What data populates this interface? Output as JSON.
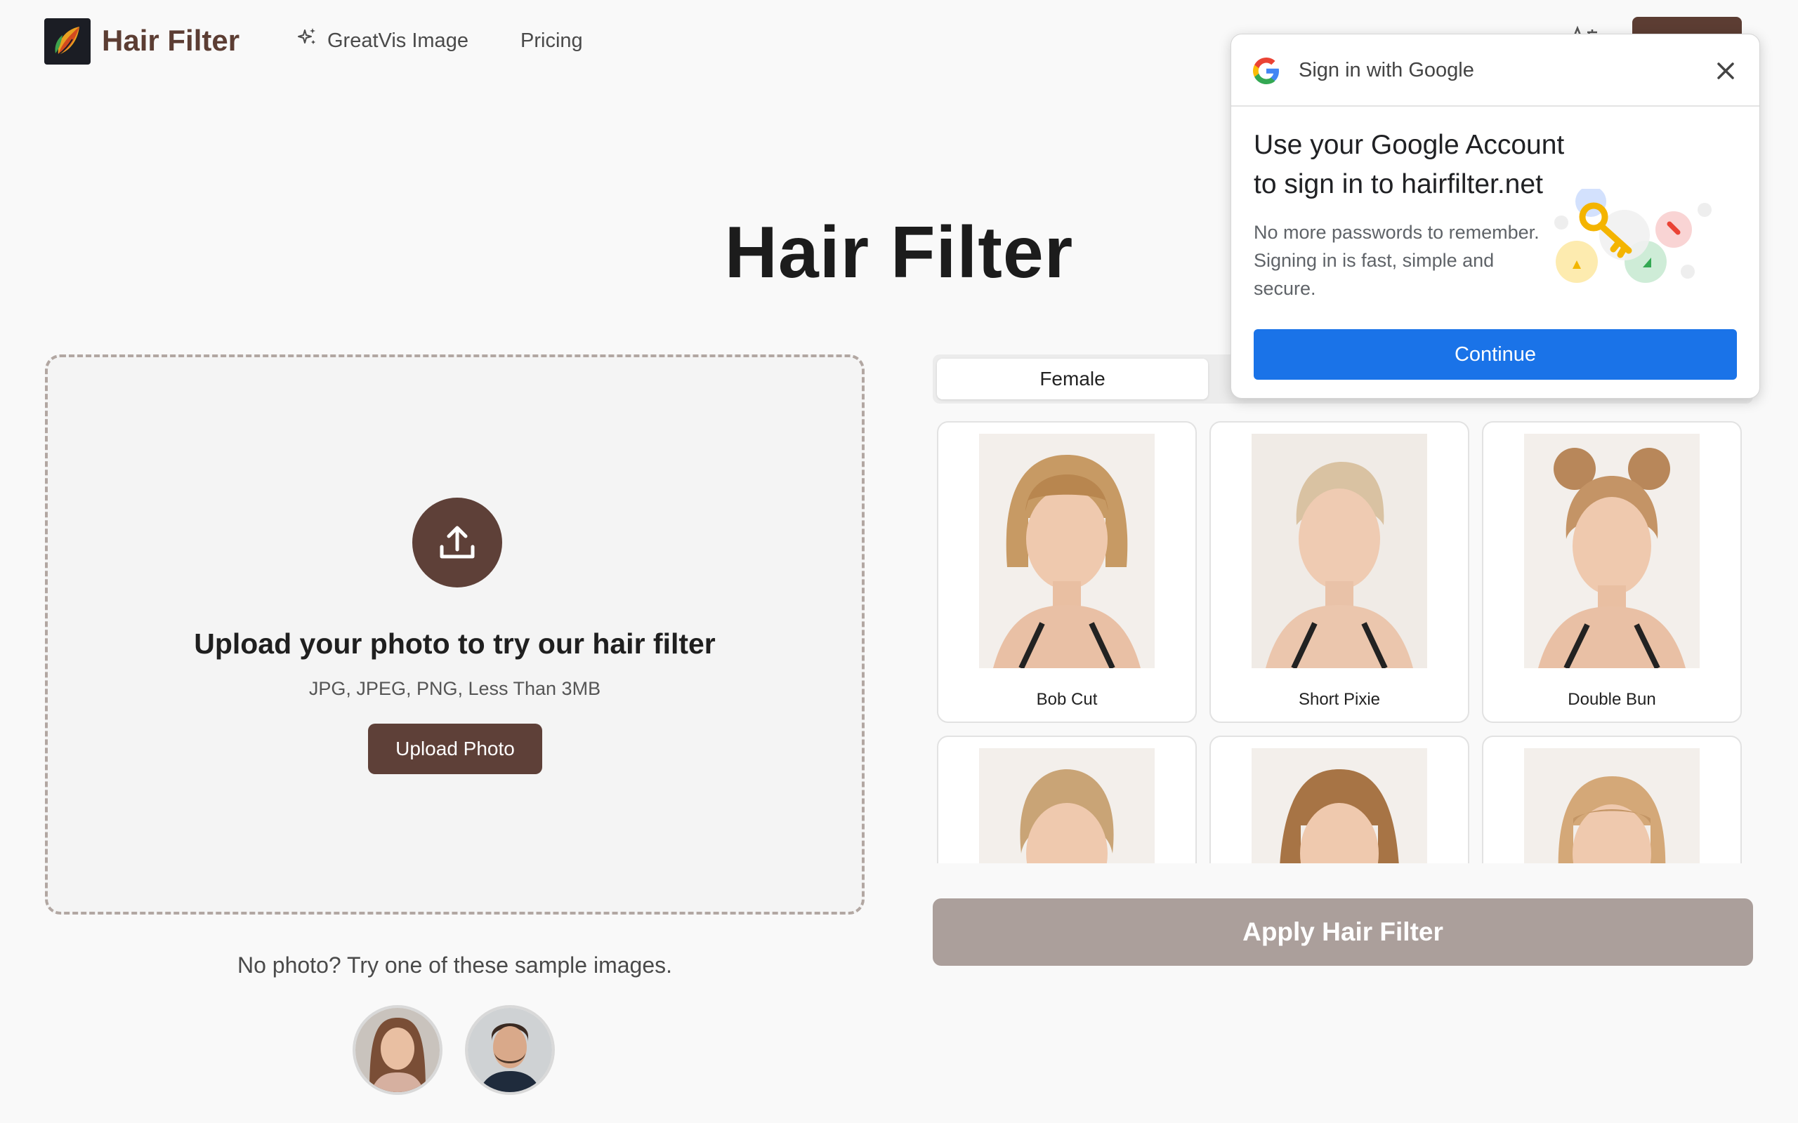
{
  "header": {
    "brand": "Hair Filter",
    "nav": [
      {
        "label": "GreatVis Image",
        "icon": "sparkle-icon"
      },
      {
        "label": "Pricing"
      }
    ],
    "brand_color": "#5c3d33"
  },
  "main": {
    "title": "Hair Filter"
  },
  "upload": {
    "heading": "Upload your photo to try our hair filter",
    "formats": "JPG, JPEG, PNG, Less Than 3MB",
    "button_label": "Upload Photo",
    "icon": "upload-icon"
  },
  "samples": {
    "text": "No photo? Try one of these sample images."
  },
  "style_panel": {
    "tabs": [
      {
        "label": "Female",
        "selected": true
      }
    ],
    "styles": [
      {
        "label": "Bob Cut"
      },
      {
        "label": "Short Pixie"
      },
      {
        "label": "Double Bun"
      },
      {
        "label": ""
      },
      {
        "label": ""
      },
      {
        "label": ""
      }
    ],
    "apply_label": "Apply Hair Filter",
    "apply_color": "#ab9f9b"
  },
  "google_popup": {
    "header": "Sign in with Google",
    "title": "Use your Google Account to sign in to hairfilter.net",
    "description": "No more passwords to remember. Signing in is fast, simple and secure.",
    "continue_label": "Continue",
    "accent_color": "#1a73e8"
  }
}
